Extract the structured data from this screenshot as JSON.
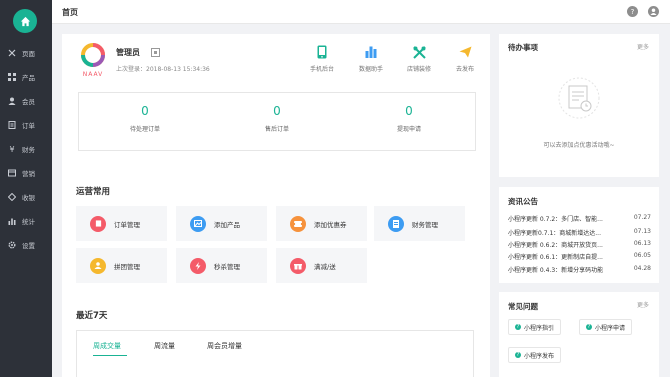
{
  "sidebar": {
    "items": [
      {
        "label": "页面",
        "icon": "tools-icon"
      },
      {
        "label": "产品",
        "icon": "grid-icon"
      },
      {
        "label": "会员",
        "icon": "user-icon"
      },
      {
        "label": "订单",
        "icon": "order-icon"
      },
      {
        "label": "财务",
        "icon": "yen-icon"
      },
      {
        "label": "营销",
        "icon": "marketing-icon"
      },
      {
        "label": "收银",
        "icon": "cashier-icon"
      },
      {
        "label": "统计",
        "icon": "chart-icon"
      },
      {
        "label": "设置",
        "icon": "gear-icon"
      }
    ]
  },
  "topbar": {
    "title": "首页",
    "help": "?"
  },
  "profile": {
    "name": "管理员",
    "last_login_label": "上次登录：",
    "last_login_time": "2018-08-13 15:34:36",
    "logo_text": "NAAV"
  },
  "quick_actions": [
    {
      "label": "手机后台",
      "icon": "mobile-icon"
    },
    {
      "label": "数据助手",
      "icon": "bar-chart-icon"
    },
    {
      "label": "店铺装修",
      "icon": "wrench-icon"
    },
    {
      "label": "去发布",
      "icon": "send-icon"
    }
  ],
  "stats": [
    {
      "value": "0",
      "label": "待处理订单"
    },
    {
      "value": "0",
      "label": "售后订单"
    },
    {
      "value": "0",
      "label": "提现申请"
    }
  ],
  "common_ops": {
    "title": "运营常用",
    "tiles": [
      {
        "label": "订单管理",
        "color": "#f45b69",
        "icon": "order-icon"
      },
      {
        "label": "添加产品",
        "color": "#3d9cf2",
        "icon": "image-icon"
      },
      {
        "label": "添加优惠券",
        "color": "#f6923c",
        "icon": "coupon-icon"
      },
      {
        "label": "财务管理",
        "color": "#3d9cf2",
        "icon": "doc-icon"
      },
      {
        "label": "拼团管理",
        "color": "#f5b82e",
        "icon": "group-icon"
      },
      {
        "label": "秒杀管理",
        "color": "#f45b69",
        "icon": "flash-icon"
      },
      {
        "label": "满减/送",
        "color": "#f45b69",
        "icon": "gift-icon"
      }
    ]
  },
  "recent": {
    "title": "最近7天",
    "tabs": [
      "周成交量",
      "周流量",
      "周会员增量"
    ],
    "active_tab": "周成交量"
  },
  "todo": {
    "title": "待办事项",
    "more": "更多",
    "empty_text": "可以去添加点优惠活动哦~"
  },
  "news": {
    "title": "资讯公告",
    "items": [
      {
        "text": "小程序更新 0.7.2：多门店、智能...",
        "date": "07.27"
      },
      {
        "text": "小程序更新0.7.1：商城新增达达...",
        "date": "07.13"
      },
      {
        "text": "小程序更新 0.6.2：商城开放货页...",
        "date": "06.13"
      },
      {
        "text": "小程序更新 0.6.1：更新制店自提...",
        "date": "06.05"
      },
      {
        "text": "小程序更新 0.4.3：新增分享码功能",
        "date": "04.28"
      }
    ]
  },
  "faq": {
    "title": "常见问题",
    "more": "更多",
    "items": [
      "小程序指引",
      "小程序申请",
      "小程序发布"
    ]
  },
  "colors": {
    "accent": "#1ab394",
    "sidebar_bg": "#2d3139"
  }
}
